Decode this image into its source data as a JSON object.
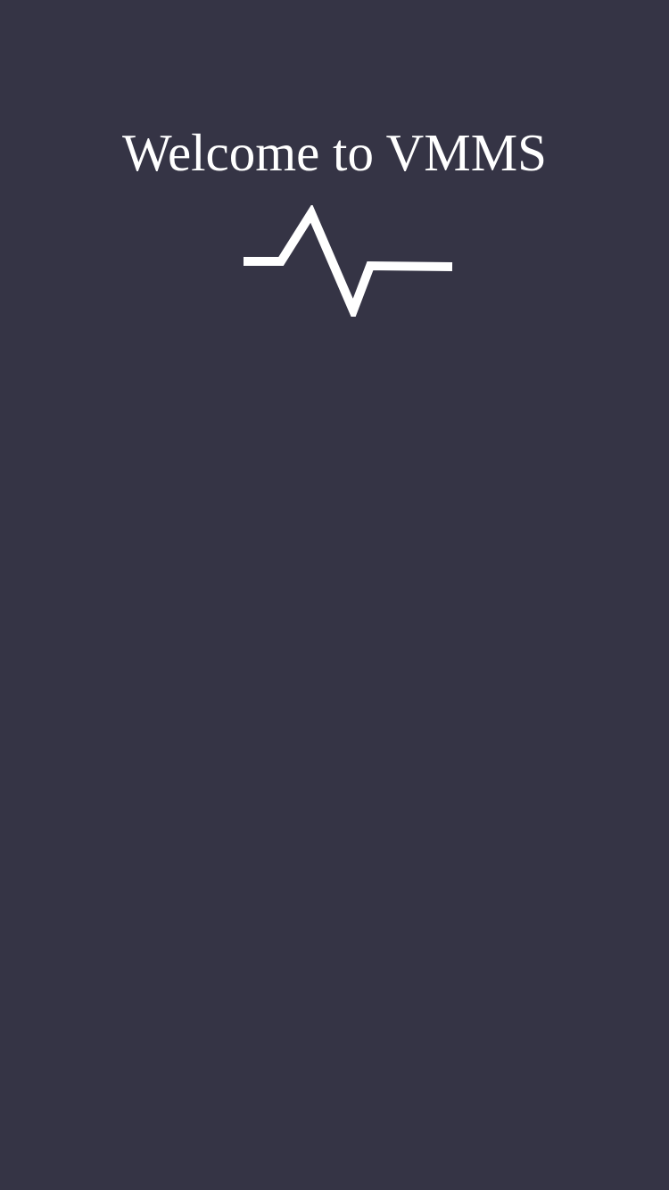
{
  "screen": {
    "title": "Welcome to VMMS",
    "background_color": "#353445",
    "accent_color": "#ffffff",
    "logo_icon": "heartbeat-pulse-icon"
  }
}
